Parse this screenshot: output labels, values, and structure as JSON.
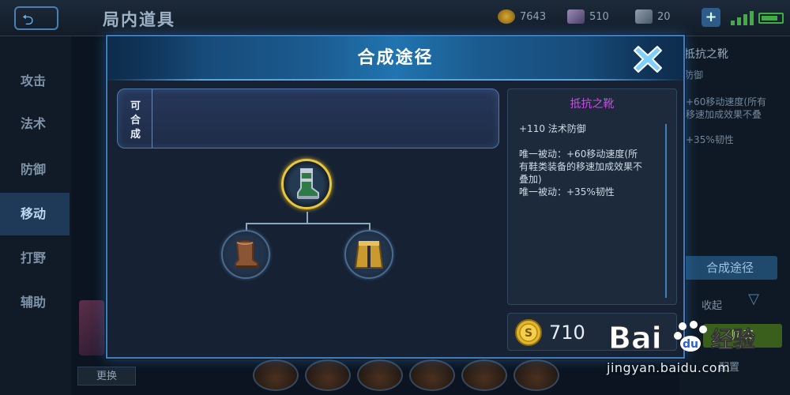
{
  "topbar": {
    "title": "局内道具",
    "gold": "7643",
    "diamonds": "510",
    "coupons": "20",
    "plus_label": "+"
  },
  "sidebar": {
    "items": [
      {
        "label": "攻击"
      },
      {
        "label": "法术"
      },
      {
        "label": "防御"
      },
      {
        "label": "移动",
        "active": true
      },
      {
        "label": "打野"
      },
      {
        "label": "辅助"
      }
    ]
  },
  "right_panel": {
    "item_name": "抵抗之靴",
    "sub": "防御",
    "lines": [
      "+60移动速度(所有",
      "移速加成效果不叠",
      "+35%韧性"
    ],
    "compose_button": "合成途径",
    "collapse_label": "收起",
    "button2": "购买",
    "button3": "配置"
  },
  "bottom": {
    "change_button": "更换"
  },
  "modal": {
    "title": "合成途径",
    "craft_label": [
      "可",
      "合",
      "成"
    ],
    "tree": {
      "main_item": "boots-of-resistance-icon",
      "components": [
        "leather-boots-icon",
        "golden-cloak-icon"
      ]
    },
    "description": {
      "title": "抵抗之靴",
      "title_color": "#c74ee0",
      "lines": [
        "+110 法术防御",
        "",
        "唯一被动：+60移动速度(所",
        "有鞋类装备的移速加成效果不",
        "叠加)",
        "唯一被动：+35%韧性"
      ]
    },
    "price": "710"
  },
  "watermark": {
    "brand": "Bai 经验",
    "url": "jingyan.baidu.com"
  },
  "colors": {
    "accent": "#3d7fbe",
    "gold_border": "#e8c53a",
    "modal_bg": "#162233"
  }
}
